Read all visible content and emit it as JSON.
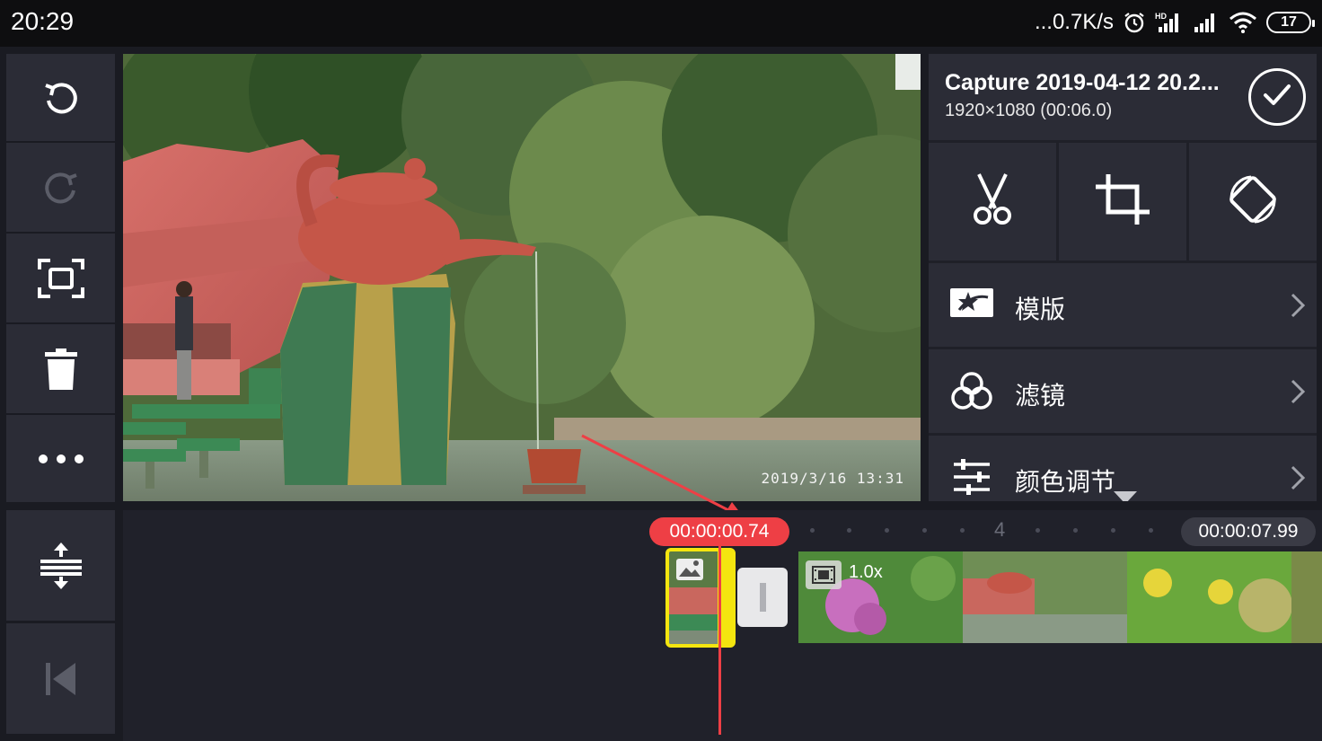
{
  "status_bar": {
    "time": "20:29",
    "network_speed": "...0.7K/s",
    "battery_level": "17",
    "icons": [
      "alarm-icon",
      "hd-signal-icon",
      "signal-icon",
      "wifi-icon",
      "battery-icon"
    ]
  },
  "left_toolbar": {
    "items": [
      "undo-icon",
      "redo-icon",
      "fullscreen-icon",
      "delete-icon",
      "more-icon",
      "align-icon",
      "skip-to-start-icon"
    ]
  },
  "preview": {
    "timestamp": "2019/3/16  13:31"
  },
  "clip_panel": {
    "title": "Capture 2019-04-12 20.2...",
    "meta": "1920×1080 (00:06.0)",
    "actions": [
      "scissors-icon",
      "crop-icon",
      "rotate-icon"
    ],
    "menu": [
      {
        "label": "模版",
        "icon": "template-icon"
      },
      {
        "label": "滤镜",
        "icon": "filter-icon"
      },
      {
        "label": "颜色调节",
        "icon": "color-adjust-icon"
      }
    ]
  },
  "timeline": {
    "playhead_time": "00:00:00.74",
    "total_time": "00:00:07.99",
    "ruler_marker": "4",
    "clip_speed": "1.0x"
  },
  "colors": {
    "accent_red": "#ee3f45",
    "selection_yellow": "#f4e50f",
    "panel_bg": "#2b2c36",
    "app_bg": "#1a1b22"
  }
}
